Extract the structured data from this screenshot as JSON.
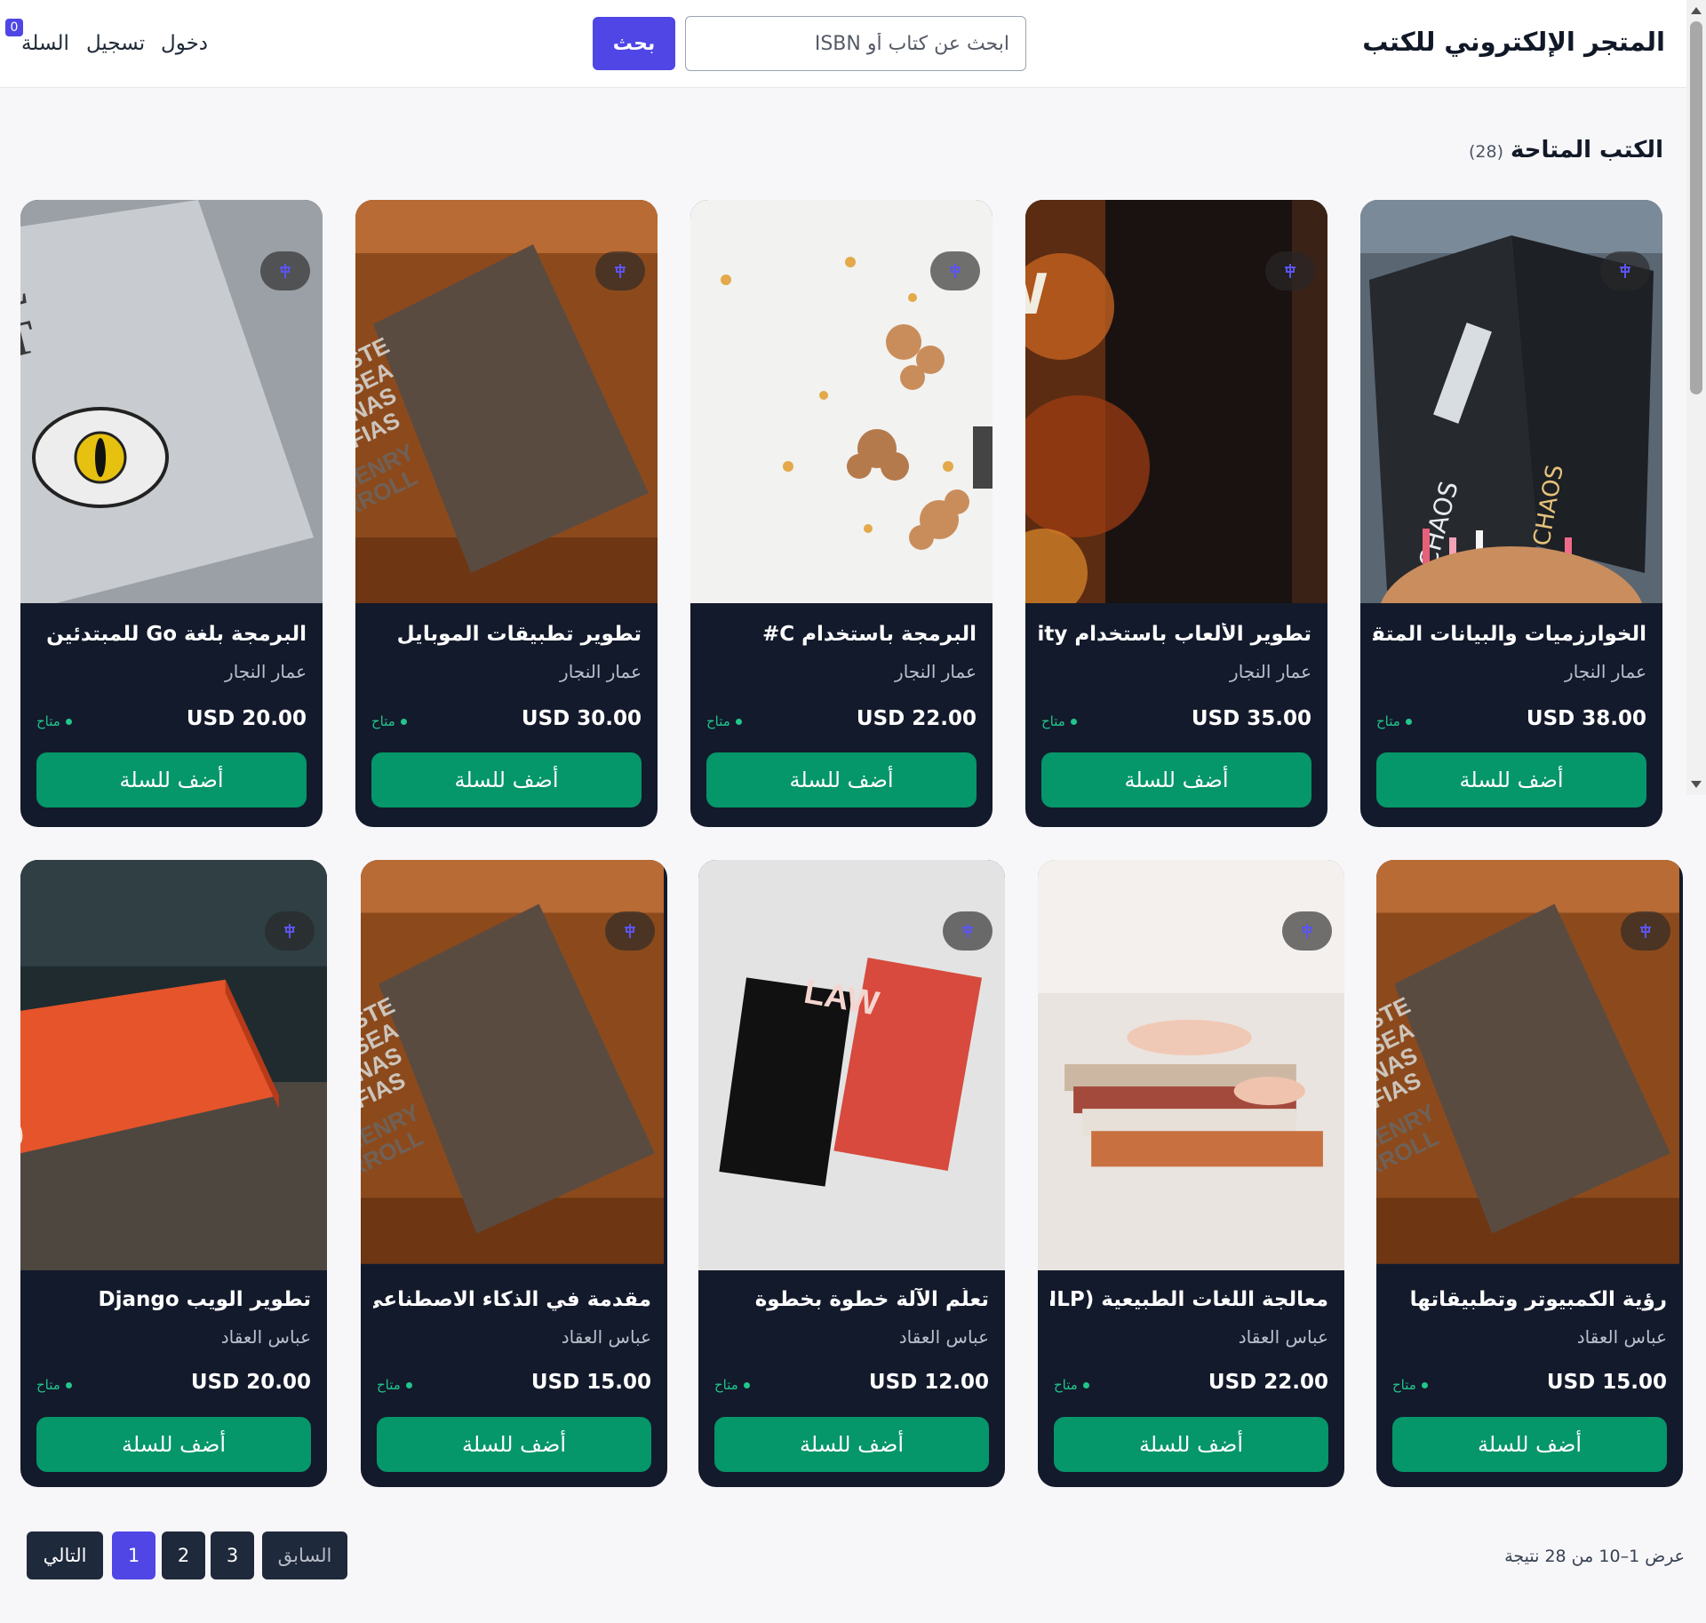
{
  "header": {
    "brand": "المتجر الإلكتروني للكتب",
    "search_placeholder": "ابحث عن كتاب أو ISBN",
    "search_button": "بحث",
    "nav": {
      "login": "دخول",
      "register": "تسجيل",
      "cart": "السلة",
      "cart_count": "0"
    }
  },
  "section": {
    "title": "الكتب المتاحة",
    "count": "(28)"
  },
  "books": [
    {
      "title": "الخوارزميات والبيانات المتقدمة",
      "author": "عمار النجار",
      "price": "USD 38.00",
      "status": "متاح",
      "add_label": "أضف للسلة",
      "image": "chaos-book-cover"
    },
    {
      "title": "تطوير الألعاب باستخدام Unity",
      "author": "عمار النجار",
      "price": "USD 35.00",
      "status": "متاح",
      "add_label": "أضف للسلة",
      "image": "new-england-book-cover"
    },
    {
      "title": "البرمجة باستخدام C#",
      "author": "عمار النجار",
      "price": "USD 22.00",
      "status": "متاح",
      "add_label": "أضف للسلة",
      "image": "autumn-leaves-photo"
    },
    {
      "title": "تطوير تطبيقات الموبايل",
      "author": "عمار النجار",
      "price": "USD 30.00",
      "status": "متاح",
      "add_label": "أضف للسلة",
      "image": "lea-este-libro-cover"
    },
    {
      "title": "البرمجة بلغة Go للمبتدئين",
      "author": "عمار النجار",
      "price": "USD 20.00",
      "status": "متاح",
      "add_label": "أضف للسلة",
      "image": "animal-spirit-eye-cover"
    },
    {
      "title": "رؤية الكمبيوتر وتطبيقاتها",
      "author": "عباس العقاد",
      "price": "USD 15.00",
      "status": "متاح",
      "add_label": "أضف للسلة",
      "image": "lea-este-libro-cover"
    },
    {
      "title": "معالجة اللغات الطبيعية (NLP)",
      "author": "عباس العقاد",
      "price": "USD 22.00",
      "status": "متاح",
      "add_label": "أضف للسلة",
      "image": "hands-stacking-books-photo"
    },
    {
      "title": "تعلّم الآلة خطوة بخطوة",
      "author": "عباس العقاد",
      "price": "USD 12.00",
      "status": "متاح",
      "add_label": "أضف للسلة",
      "image": "law-notebooks-photo"
    },
    {
      "title": "مقدمة في الذكاء الاصطناعي",
      "author": "عباس العقاد",
      "price": "USD 15.00",
      "status": "متاح",
      "add_label": "أضف للسلة",
      "image": "lea-este-libro-cover"
    },
    {
      "title": "تطوير الويب Django",
      "author": "عباس العقاد",
      "price": "USD 20.00",
      "status": "متاح",
      "add_label": "أضف للسلة",
      "image": "1000-chairs-book-cover"
    }
  ],
  "pagination": {
    "info": "عرض 1–10 من 28 نتيجة",
    "prev": "السابق",
    "pages": [
      "3",
      "2",
      "1"
    ],
    "current": "1",
    "next": "التالي"
  },
  "colors": {
    "accent": "#4f46e5",
    "add_button": "#059669",
    "card_bg": "#131a2b",
    "status": "#22c58b"
  }
}
